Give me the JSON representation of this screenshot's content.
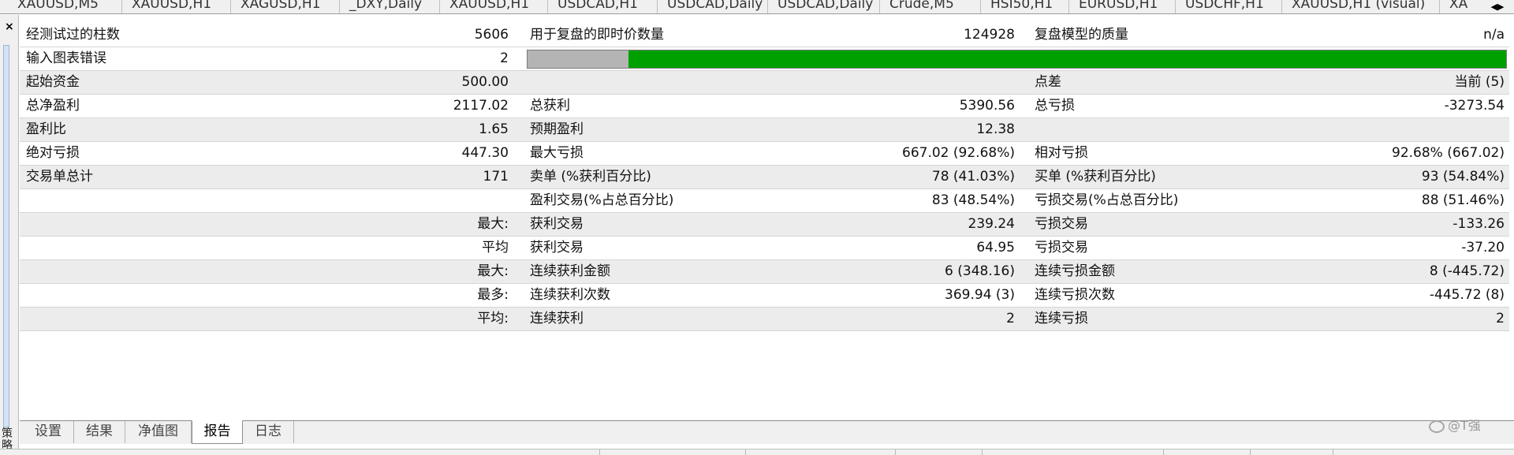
{
  "chart_tabs": [
    "XAUUSD,M5",
    "XAUUSD,H1",
    "XAGUSD,H1",
    "_DXY,Daily",
    "XAUUSD,H1",
    "USDCAD,H1",
    "USDCAD,Daily",
    "USDCAD,Daily",
    "Crude,M5",
    "HSI50,H1",
    "EURUSD,H1",
    "USDCHF,H1",
    "XAUUSD,H1 (visual)",
    "XA"
  ],
  "close_label": "×",
  "side_label": "策略",
  "rows": [
    {
      "c1": {
        "label": "经测试过的柱数",
        "value": "5606"
      },
      "c2": {
        "label": "用于复盘的即时价数量",
        "value": "124928"
      },
      "c3": {
        "label": "复盘模型的质量",
        "value": "n/a"
      }
    },
    {
      "c1": {
        "label": "输入图表错误",
        "value": "2"
      },
      "progress": {
        "fraction": 0.897
      }
    },
    {
      "c1": {
        "label": "起始资金",
        "value": "500.00"
      },
      "c2": {
        "label": "",
        "value": ""
      },
      "c3": {
        "label": "点差",
        "value": "当前 (5)"
      }
    },
    {
      "c1": {
        "label": "总净盈利",
        "value": "2117.02"
      },
      "c2": {
        "label": "总获利",
        "value": "5390.56"
      },
      "c3": {
        "label": "总亏损",
        "value": "-3273.54"
      }
    },
    {
      "c1": {
        "label": "盈利比",
        "value": "1.65"
      },
      "c2": {
        "label": "预期盈利",
        "value": "12.38"
      },
      "c3": {
        "label": "",
        "value": ""
      }
    },
    {
      "c1": {
        "label": "绝对亏损",
        "value": "447.30"
      },
      "c2": {
        "label": "最大亏损",
        "value": "667.02 (92.68%)"
      },
      "c3": {
        "label": "相对亏损",
        "value": "92.68% (667.02)"
      }
    },
    {
      "c1": {
        "label": "交易单总计",
        "value": "171"
      },
      "c2": {
        "label": "卖单 (%获利百分比)",
        "value": "78 (41.03%)"
      },
      "c3": {
        "label": "买单 (%获利百分比)",
        "value": "93 (54.84%)"
      }
    },
    {
      "c1": {
        "label": "",
        "value": ""
      },
      "c2": {
        "label": "盈利交易(%占总百分比)",
        "value": "83 (48.54%)"
      },
      "c3": {
        "label": "亏损交易(%占总百分比)",
        "value": "88 (51.46%)"
      }
    },
    {
      "c1": {
        "label": "",
        "value": "最大:"
      },
      "c2": {
        "label": "获利交易",
        "value": "239.24"
      },
      "c3": {
        "label": "亏损交易",
        "value": "-133.26"
      }
    },
    {
      "c1": {
        "label": "",
        "value": "平均"
      },
      "c2": {
        "label": "获利交易",
        "value": "64.95"
      },
      "c3": {
        "label": "亏损交易",
        "value": "-37.20"
      }
    },
    {
      "c1": {
        "label": "",
        "value": "最大:"
      },
      "c2": {
        "label": "连续获利金额",
        "value": "6 (348.16)"
      },
      "c3": {
        "label": "连续亏损金额",
        "value": "8 (-445.72)"
      }
    },
    {
      "c1": {
        "label": "",
        "value": "最多:"
      },
      "c2": {
        "label": "连续获利次数",
        "value": "369.94 (3)"
      },
      "c3": {
        "label": "连续亏损次数",
        "value": "-445.72 (8)"
      }
    },
    {
      "c1": {
        "label": "",
        "value": "平均:"
      },
      "c2": {
        "label": "连续获利",
        "value": "2"
      },
      "c3": {
        "label": "连续亏损",
        "value": "2"
      }
    }
  ],
  "bottom_tabs": [
    {
      "label": "设置",
      "active": false
    },
    {
      "label": "结果",
      "active": false
    },
    {
      "label": "净值图",
      "active": false
    },
    {
      "label": "报告",
      "active": true
    },
    {
      "label": "日志",
      "active": false
    }
  ],
  "watermark": "@T强",
  "colors": {
    "progress_fill": "#00a000",
    "progress_bg": "#b4b4b4",
    "row_gray": "#ececec"
  }
}
